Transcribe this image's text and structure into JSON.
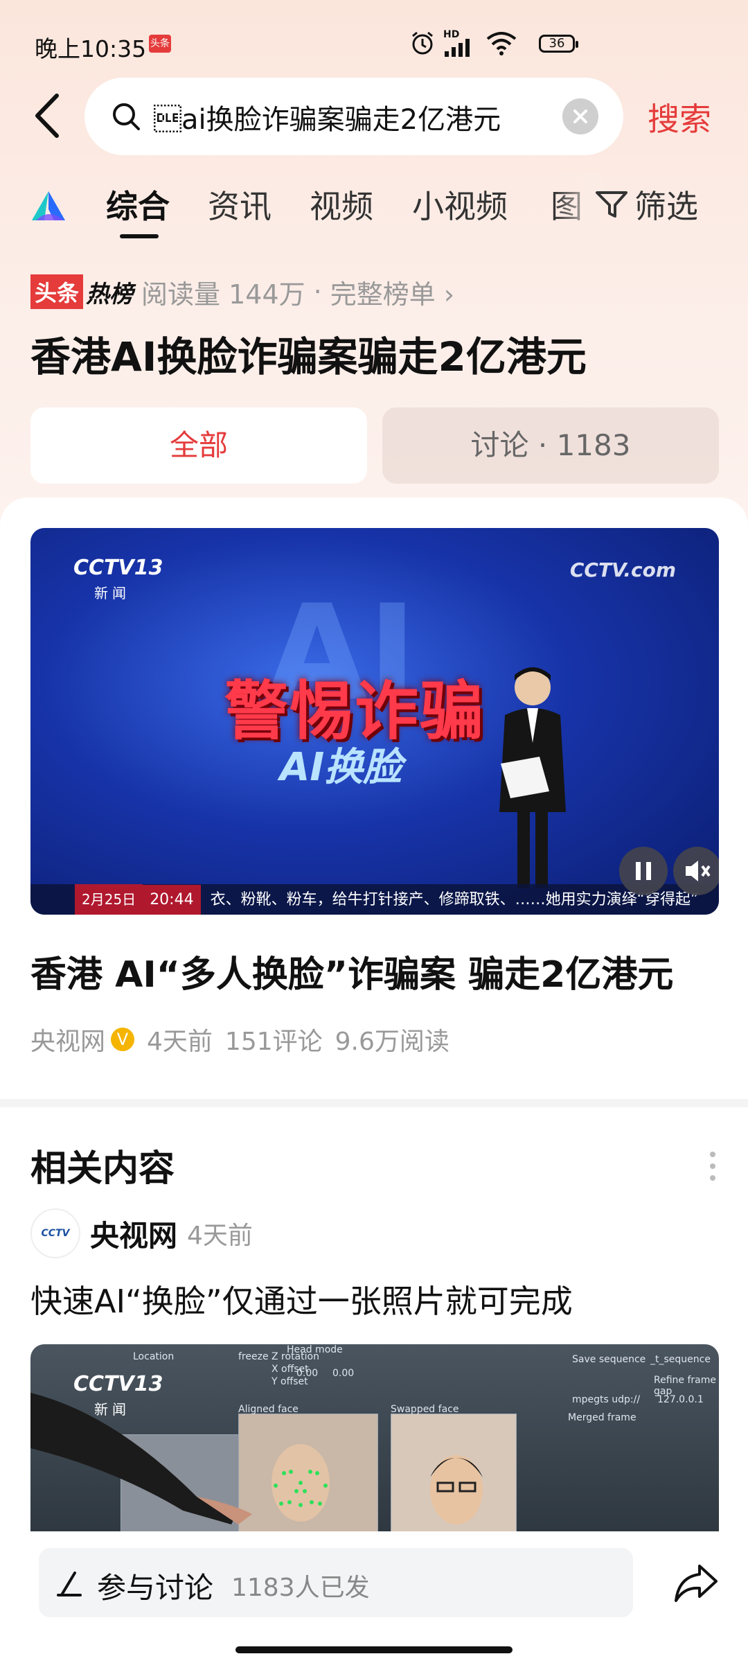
{
  "status": {
    "time": "晚上10:35",
    "battery": "36",
    "network_label": "HD",
    "app_badge": "头条"
  },
  "search": {
    "query": "\u0010ai换脸诈骗案骗走2亿港元",
    "button_label": "搜索"
  },
  "tabs": [
    {
      "label": "综合",
      "active": true
    },
    {
      "label": "资讯"
    },
    {
      "label": "视频"
    },
    {
      "label": "小视频"
    },
    {
      "label": "图"
    }
  ],
  "filter_label": "筛选",
  "hot": {
    "badge_a": "头条",
    "badge_b": "热榜",
    "reads": "阅读量 144万",
    "separator": "·",
    "full_list": "完整榜单 ›"
  },
  "page_title": "香港AI换脸诈骗案骗走2亿港元",
  "segments": {
    "all": "全部",
    "discuss": "讨论 · 1183"
  },
  "video": {
    "channel": "CCTV13",
    "channel_sub": "新闻",
    "site_logo": "CCTV.com",
    "big_text": "AI",
    "alert": "警惕诈骗",
    "subtitle": "AI换脸",
    "ticker_date": "2月25日",
    "ticker_time": "20:44",
    "ticker_text": "衣、粉靴、粉车，给牛打针接产、修蹄取铁、……她用实力演绎“穿得起”"
  },
  "article": {
    "title": "香港 AI“多人换脸”诈骗案 骗走2亿港元",
    "source": "央视网",
    "time": "4天前",
    "comments": "151评论",
    "reads": "9.6万阅读"
  },
  "related": {
    "title": "相关内容",
    "source": "央视网",
    "time": "4天前",
    "headline": "快速AI“换脸”仅通过一张照片就可完成",
    "thumb_channel": "CCTV13",
    "thumb_sub": "新闻",
    "ui_labels": [
      "Aligned face",
      "Swapped face",
      "Save sequence",
      "Merged frame",
      "freeze Z rotation",
      "X offset",
      "Y offset",
      "Location",
      "127.0.0.1",
      "mpegts udp://",
      "0.00",
      "0.00",
      "Head mode",
      "_t_sequence",
      "Refine frame gap"
    ]
  },
  "bottom": {
    "discuss_label": "参与讨论",
    "discuss_count": "1183人已发"
  },
  "colors": {
    "accent": "#e53b3b",
    "muted": "#999999"
  }
}
